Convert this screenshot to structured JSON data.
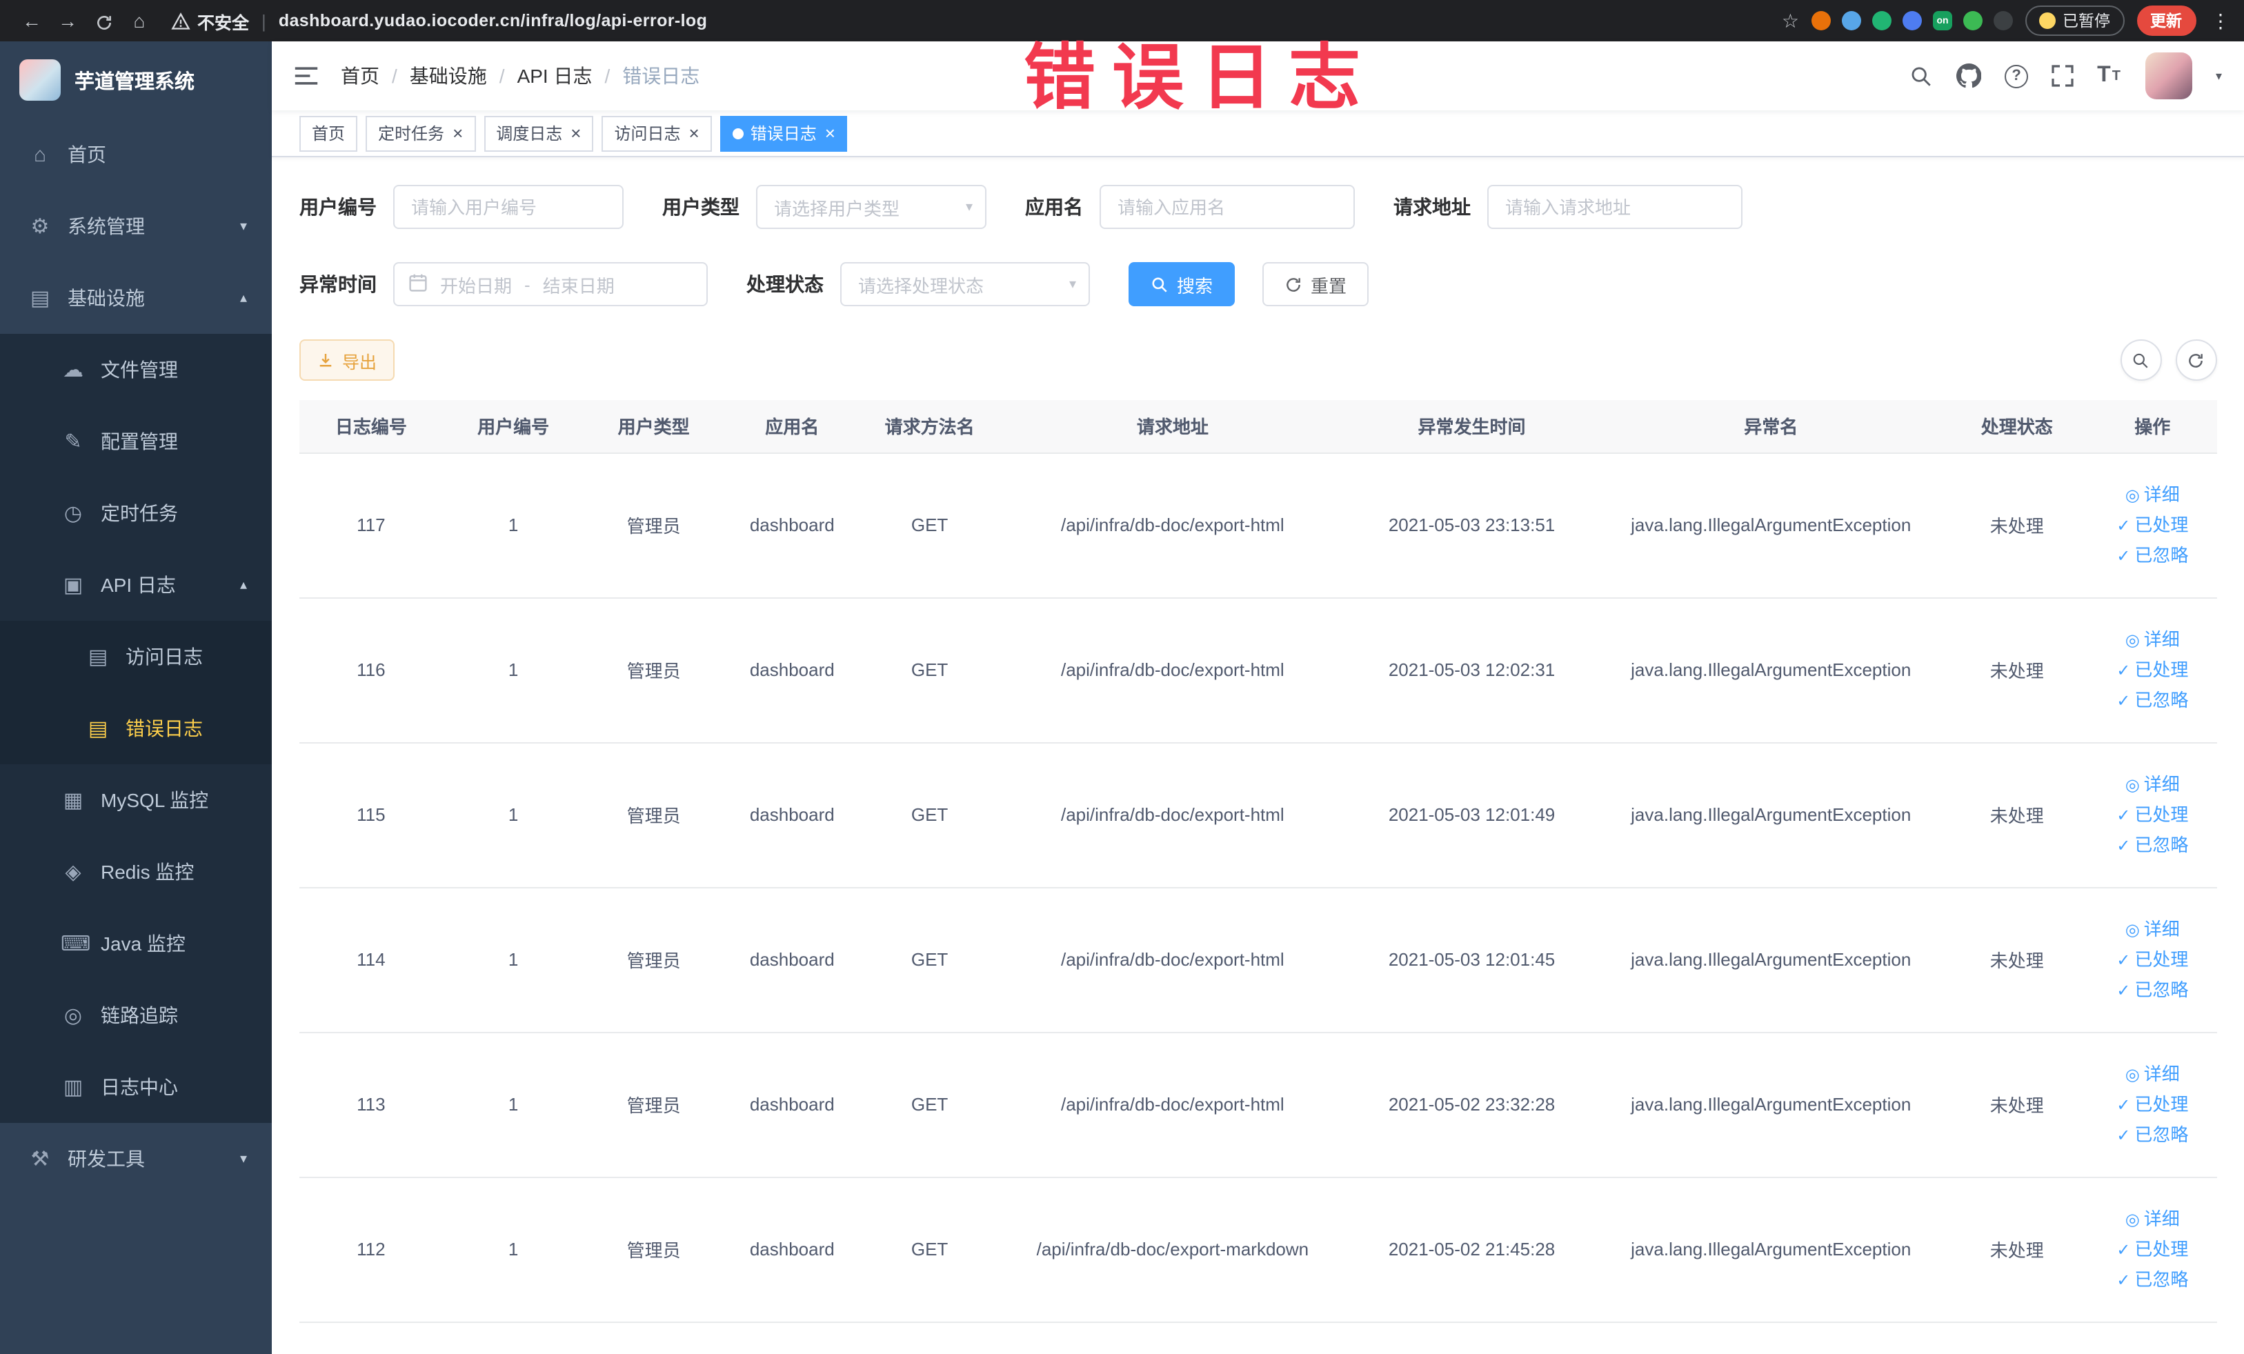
{
  "browser": {
    "insecure_label": "不安全",
    "url": "dashboard.yudao.iocoder.cn/infra/log/api-error-log",
    "paused_label": "已暂停",
    "update_label": "更新",
    "extensions": [
      {
        "key": "extension-orange",
        "color": "#e8710a",
        "text": ""
      },
      {
        "key": "extension-blue",
        "color": "#58a6e8",
        "text": ""
      },
      {
        "key": "extension-green-circle",
        "color": "#21b573",
        "text": ""
      },
      {
        "key": "extension-blue-grid",
        "color": "#4e7cf0",
        "text": ""
      },
      {
        "key": "extension-on-toggle",
        "color": "#17a05e",
        "text": "on"
      },
      {
        "key": "extension-green-leaf",
        "color": "#3cba54",
        "text": ""
      },
      {
        "key": "extension-dark",
        "color": "#3c4043",
        "text": ""
      }
    ]
  },
  "watermark": "错误日志",
  "sidebar": {
    "logo_title": "芋道管理系统",
    "items": [
      {
        "key": "home",
        "label": "首页",
        "icon": "home-icon",
        "glyph": "⌂",
        "level": 1
      },
      {
        "key": "system-management",
        "label": "系统管理",
        "icon": "gear-icon",
        "glyph": "⚙",
        "level": 1,
        "arrow": "down"
      },
      {
        "key": "infrastructure",
        "label": "基础设施",
        "icon": "infrastructure-icon",
        "glyph": "▤",
        "level": 1,
        "arrow": "up"
      },
      {
        "key": "file-management",
        "label": "文件管理",
        "icon": "file-icon",
        "glyph": "☁",
        "level": 2
      },
      {
        "key": "config-management",
        "label": "配置管理",
        "icon": "config-icon",
        "glyph": "✎",
        "level": 2
      },
      {
        "key": "scheduled-tasks",
        "label": "定时任务",
        "icon": "timer-icon",
        "glyph": "◷",
        "level": 2
      },
      {
        "key": "api-log",
        "label": "API 日志",
        "icon": "api-log-icon",
        "glyph": "▣",
        "level": 2,
        "arrow": "up"
      },
      {
        "key": "access-log",
        "label": "访问日志",
        "icon": "access-log-icon",
        "glyph": "▤",
        "level": 3
      },
      {
        "key": "error-log",
        "label": "错误日志",
        "icon": "error-log-icon",
        "glyph": "▤",
        "level": 3,
        "active": true
      },
      {
        "key": "mysql-monitor",
        "label": "MySQL 监控",
        "icon": "mysql-icon",
        "glyph": "▦",
        "level": 2
      },
      {
        "key": "redis-monitor",
        "label": "Redis 监控",
        "icon": "redis-icon",
        "glyph": "◈",
        "level": 2
      },
      {
        "key": "java-monitor",
        "label": "Java 监控",
        "icon": "java-icon",
        "glyph": "⌨",
        "level": 2
      },
      {
        "key": "trace",
        "label": "链路追踪",
        "icon": "trace-icon",
        "glyph": "◎",
        "level": 2
      },
      {
        "key": "log-center",
        "label": "日志中心",
        "icon": "log-center-icon",
        "glyph": "▥",
        "level": 2
      },
      {
        "key": "dev-tools",
        "label": "研发工具",
        "icon": "tools-icon",
        "glyph": "⚒",
        "level": 1,
        "arrow": "down"
      }
    ]
  },
  "breadcrumb": [
    "首页",
    "基础设施",
    "API 日志",
    "错误日志"
  ],
  "tabs": [
    {
      "key": "home",
      "label": "首页",
      "closable": false,
      "active": false
    },
    {
      "key": "scheduled-tasks",
      "label": "定时任务",
      "closable": true,
      "active": false
    },
    {
      "key": "schedule-log",
      "label": "调度日志",
      "closable": true,
      "active": false
    },
    {
      "key": "access-log",
      "label": "访问日志",
      "closable": true,
      "active": false
    },
    {
      "key": "error-log",
      "label": "错误日志",
      "closable": true,
      "active": true
    }
  ],
  "filters": {
    "user_id": {
      "label": "用户编号",
      "placeholder": "请输入用户编号"
    },
    "user_type": {
      "label": "用户类型",
      "placeholder": "请选择用户类型"
    },
    "app_name": {
      "label": "应用名",
      "placeholder": "请输入应用名"
    },
    "request_url": {
      "label": "请求地址",
      "placeholder": "请输入请求地址"
    },
    "exception_time": {
      "label": "异常时间",
      "start_placeholder": "开始日期",
      "separator": "-",
      "end_placeholder": "结束日期"
    },
    "process_status": {
      "label": "处理状态",
      "placeholder": "请选择处理状态"
    },
    "search_label": "搜索",
    "reset_label": "重置"
  },
  "toolbar": {
    "export_label": "导出"
  },
  "table": {
    "columns": [
      {
        "key": "id",
        "label": "日志编号"
      },
      {
        "key": "user_id",
        "label": "用户编号"
      },
      {
        "key": "user_type",
        "label": "用户类型"
      },
      {
        "key": "app_name",
        "label": "应用名"
      },
      {
        "key": "method",
        "label": "请求方法名"
      },
      {
        "key": "url",
        "label": "请求地址"
      },
      {
        "key": "time",
        "label": "异常发生时间"
      },
      {
        "key": "exception",
        "label": "异常名"
      },
      {
        "key": "status",
        "label": "处理状态"
      },
      {
        "key": "actions",
        "label": "操作"
      }
    ],
    "row_actions": [
      {
        "key": "detail",
        "label": "详细",
        "icon": "eye-icon",
        "glyph": "◎"
      },
      {
        "key": "processed",
        "label": "已处理",
        "icon": "check-icon",
        "glyph": "✓"
      },
      {
        "key": "ignored",
        "label": "已忽略",
        "icon": "check-icon",
        "glyph": "✓"
      }
    ],
    "rows": [
      {
        "id": "117",
        "user_id": "1",
        "user_type": "管理员",
        "app_name": "dashboard",
        "method": "GET",
        "url": "/api/infra/db-doc/export-html",
        "time": "2021-05-03 23:13:51",
        "exception": "java.lang.IllegalArgumentException",
        "status": "未处理"
      },
      {
        "id": "116",
        "user_id": "1",
        "user_type": "管理员",
        "app_name": "dashboard",
        "method": "GET",
        "url": "/api/infra/db-doc/export-html",
        "time": "2021-05-03 12:02:31",
        "exception": "java.lang.IllegalArgumentException",
        "status": "未处理"
      },
      {
        "id": "115",
        "user_id": "1",
        "user_type": "管理员",
        "app_name": "dashboard",
        "method": "GET",
        "url": "/api/infra/db-doc/export-html",
        "time": "2021-05-03 12:01:49",
        "exception": "java.lang.IllegalArgumentException",
        "status": "未处理"
      },
      {
        "id": "114",
        "user_id": "1",
        "user_type": "管理员",
        "app_name": "dashboard",
        "method": "GET",
        "url": "/api/infra/db-doc/export-html",
        "time": "2021-05-03 12:01:45",
        "exception": "java.lang.IllegalArgumentException",
        "status": "未处理"
      },
      {
        "id": "113",
        "user_id": "1",
        "user_type": "管理员",
        "app_name": "dashboard",
        "method": "GET",
        "url": "/api/infra/db-doc/export-html",
        "time": "2021-05-02 23:32:28",
        "exception": "java.lang.IllegalArgumentException",
        "status": "未处理"
      },
      {
        "id": "112",
        "user_id": "1",
        "user_type": "管理员",
        "app_name": "dashboard",
        "method": "GET",
        "url": "/api/infra/db-doc/export-markdown",
        "time": "2021-05-02 21:45:28",
        "exception": "java.lang.IllegalArgumentException",
        "status": "未处理"
      }
    ]
  },
  "colors": {
    "primary": "#409eff",
    "warning": "#e6a23c",
    "sidebar_bg": "#304156",
    "sidebar_sub_bg": "#1f2d3d",
    "active_menu": "#ffd04b",
    "watermark": "#f2394f"
  }
}
